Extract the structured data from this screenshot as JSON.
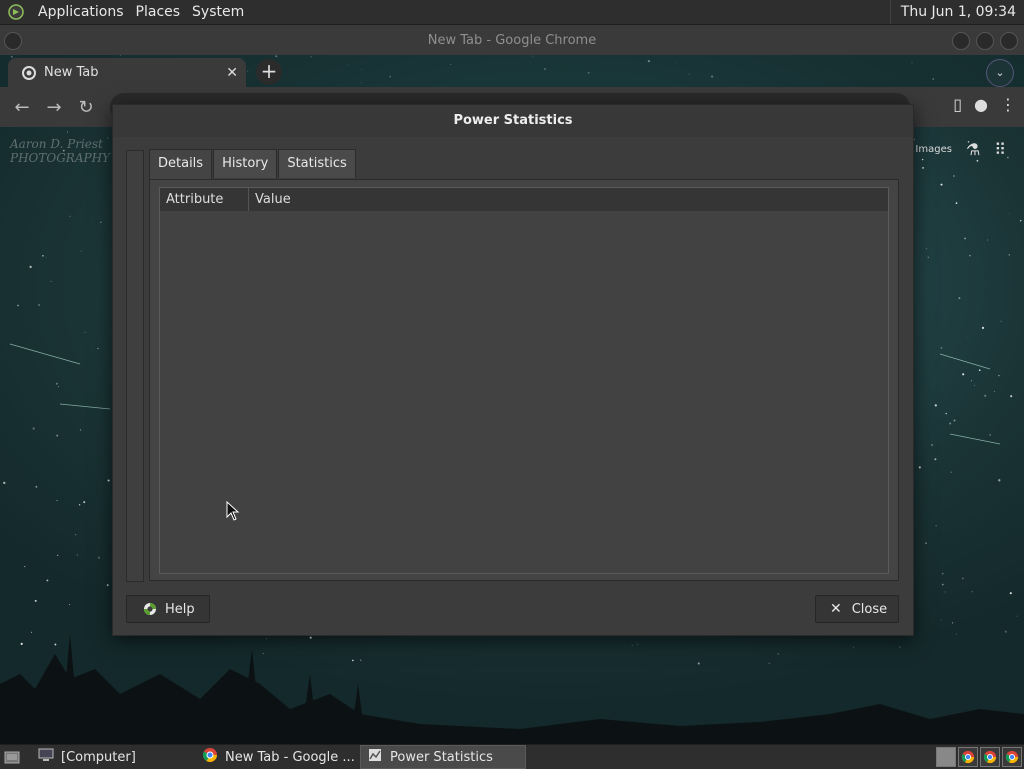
{
  "top_panel": {
    "menus": [
      "Applications",
      "Places",
      "System"
    ],
    "clock": "Thu Jun  1, 09:34"
  },
  "chrome": {
    "window_title": "New Tab - Google Chrome",
    "tab_title": "New Tab",
    "tab_close": "✕",
    "new_tab": "+",
    "images_link": "Images"
  },
  "dialog": {
    "title": "Power Statistics",
    "tabs": [
      {
        "label": "Details",
        "active": true
      },
      {
        "label": "History",
        "active": false
      },
      {
        "label": "Statistics",
        "active": false
      }
    ],
    "columns": [
      "Attribute",
      "Value"
    ],
    "rows": [],
    "help_label": "Help",
    "close_label": "Close"
  },
  "taskbar": {
    "tasks": [
      {
        "label": "[Computer]"
      },
      {
        "label": "New Tab - Google ..."
      },
      {
        "label": "Power Statistics",
        "active": true
      }
    ]
  },
  "colors": {
    "panel_bg": "#2e2e2e",
    "dialog_bg": "#3c3c3c",
    "desktop_teal": "#24474a"
  }
}
